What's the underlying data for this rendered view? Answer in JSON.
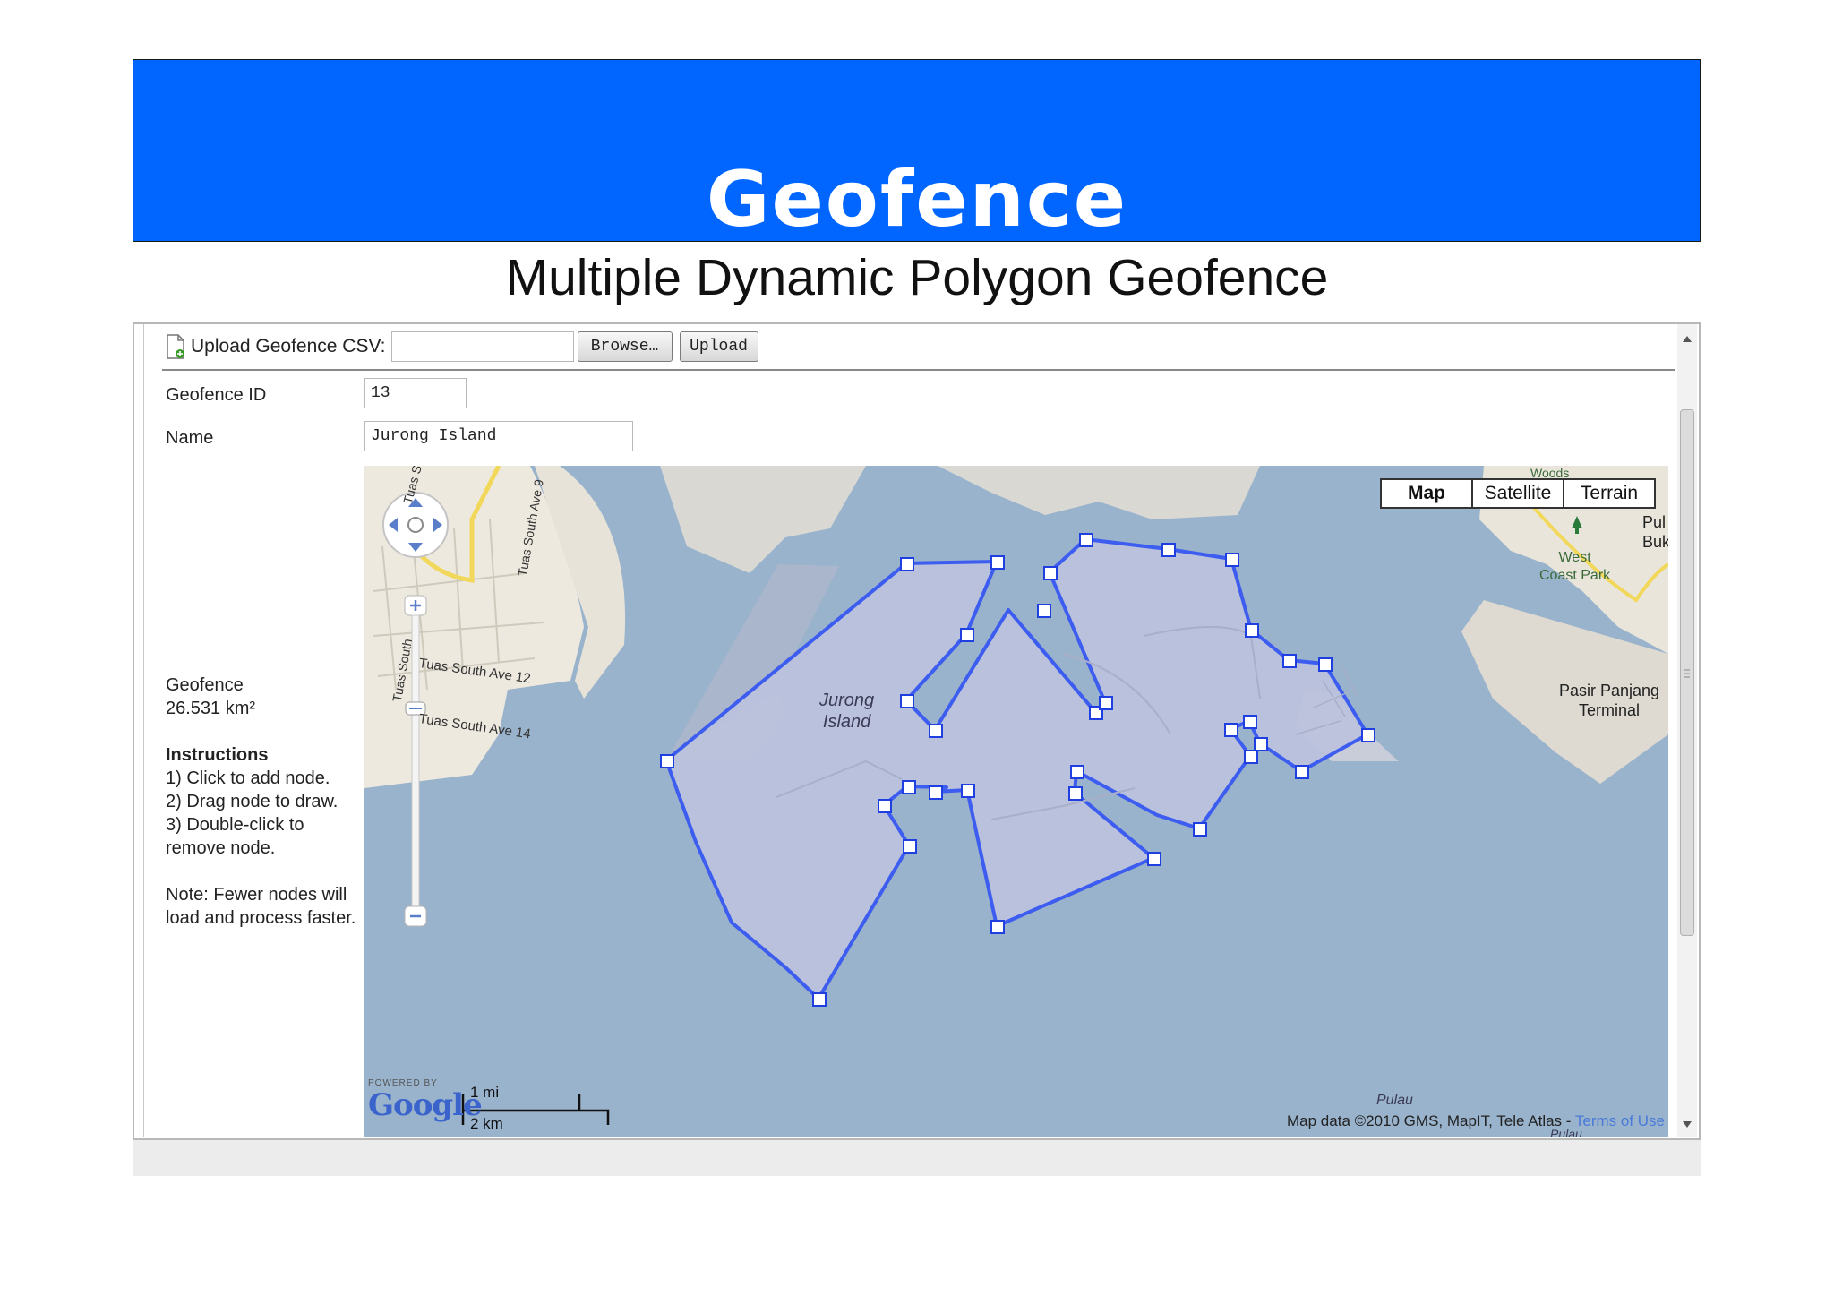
{
  "slide": {
    "title": "Geofence",
    "subtitle": "Multiple Dynamic Polygon Geofence"
  },
  "upload": {
    "label": "Upload Geofence CSV:",
    "file_value": "",
    "browse_label": "Browse…",
    "upload_label": "Upload"
  },
  "form": {
    "id_label": "Geofence ID",
    "id_value": "13",
    "name_label": "Name",
    "name_value": "Jurong Island"
  },
  "sidebar": {
    "geofence_label": "Geofence",
    "area": "26.531 km²",
    "instructions_title": "Instructions",
    "steps": [
      "1) Click to add node.",
      "2) Drag node to draw.",
      "3) Double-click to",
      "remove node."
    ],
    "note_lines": [
      "Note: Fewer nodes will",
      "load and process faster."
    ]
  },
  "map": {
    "map_types": [
      "Map",
      "Satellite",
      "Terrain"
    ],
    "selected_type": "Map",
    "labels": {
      "island": [
        "Jurong",
        "Island"
      ],
      "terminal": [
        "Pasir Panjang",
        "Terminal"
      ],
      "park": [
        "West",
        "Coast Park"
      ],
      "pul": [
        "Pul",
        "Buk"
      ],
      "woods": "Woods",
      "pulau": "Pulau",
      "pulau2": "Pulau",
      "roads": [
        "Tuas South",
        "Tuas South Ave 9",
        "Tuas South Ave 12",
        "Tuas South Ave 14",
        "Tuas South"
      ]
    },
    "powered_by": "POWERED BY",
    "google": "Google",
    "scale_mi": "1 mi",
    "scale_km": "2 km",
    "attribution": "Map data ©2010 GMS, MapIT, Tele Atlas - ",
    "terms": "Terms of Use",
    "colors": {
      "water": "#99b3cc",
      "land": "#f0ede5",
      "polygon_fill": "#bcc2dd",
      "polygon_stroke": "#3d5cf0"
    }
  }
}
